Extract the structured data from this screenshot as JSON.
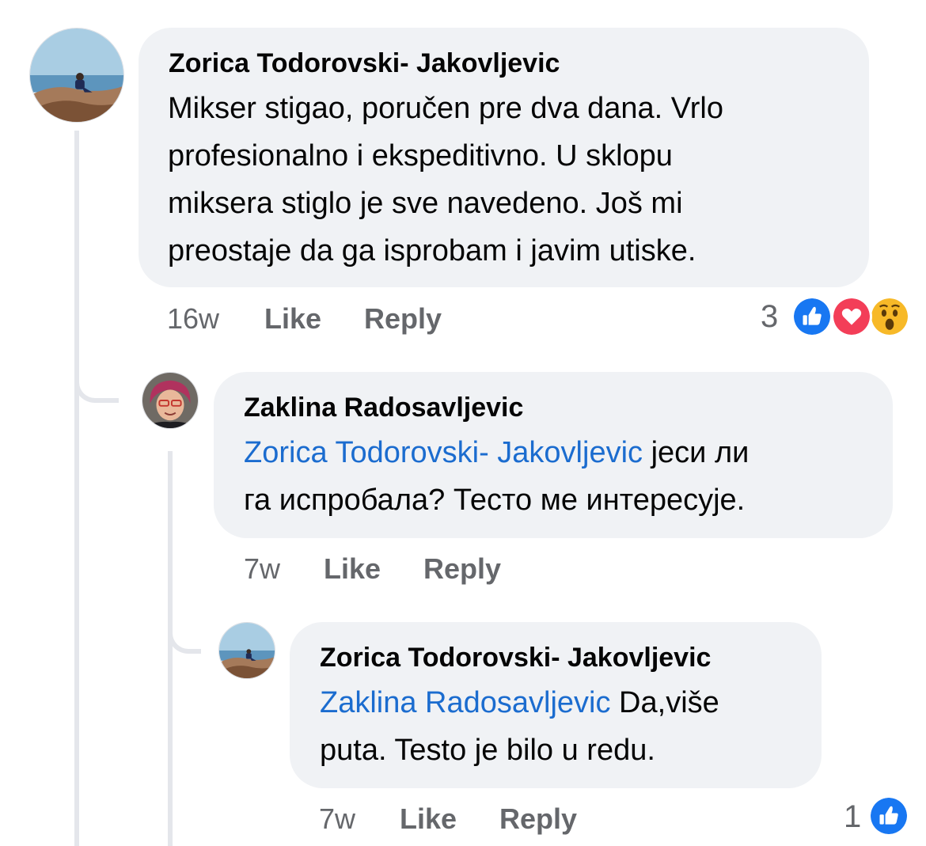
{
  "comments": [
    {
      "author": "Zorica Todorovski- Jakovljevic",
      "lines": [
        "Mikser stigao, poručen pre dva dana. Vrlo",
        "profesionalno i ekspeditivno. U sklopu",
        "miksera stiglo je sve navedeno. Još mi",
        "preostaje da ga isprobam i  javim utiske."
      ],
      "time": "16w",
      "like_label": "Like",
      "reply_label": "Reply",
      "reaction_count": "3",
      "reaction_icons": [
        "like-icon",
        "love-icon",
        "wow-icon"
      ]
    },
    {
      "author": "Zaklina Radosavljevic",
      "mention": "Zorica Todorovski- Jakovljevic",
      "line1_rest": " јеси ли",
      "line2": "га испробала? Тесто ме интересује.",
      "time": "7w",
      "like_label": "Like",
      "reply_label": "Reply"
    },
    {
      "author": "Zorica Todorovski- Jakovljevic",
      "mention": "Zaklina Radosavljevic",
      "line1_rest": " Da,više",
      "line2": "puta. Testo je bilo u redu.",
      "time": "7w",
      "like_label": "Like",
      "reply_label": "Reply",
      "reaction_count": "1",
      "reaction_icons": [
        "like-icon"
      ]
    }
  ],
  "colors": {
    "bubble": "#f0f2f5",
    "mention": "#1b6ccf",
    "meta": "#65676b",
    "like_blue": "#1877f2",
    "love_red": "#f33e58",
    "wow_yellow": "#f7b928"
  }
}
